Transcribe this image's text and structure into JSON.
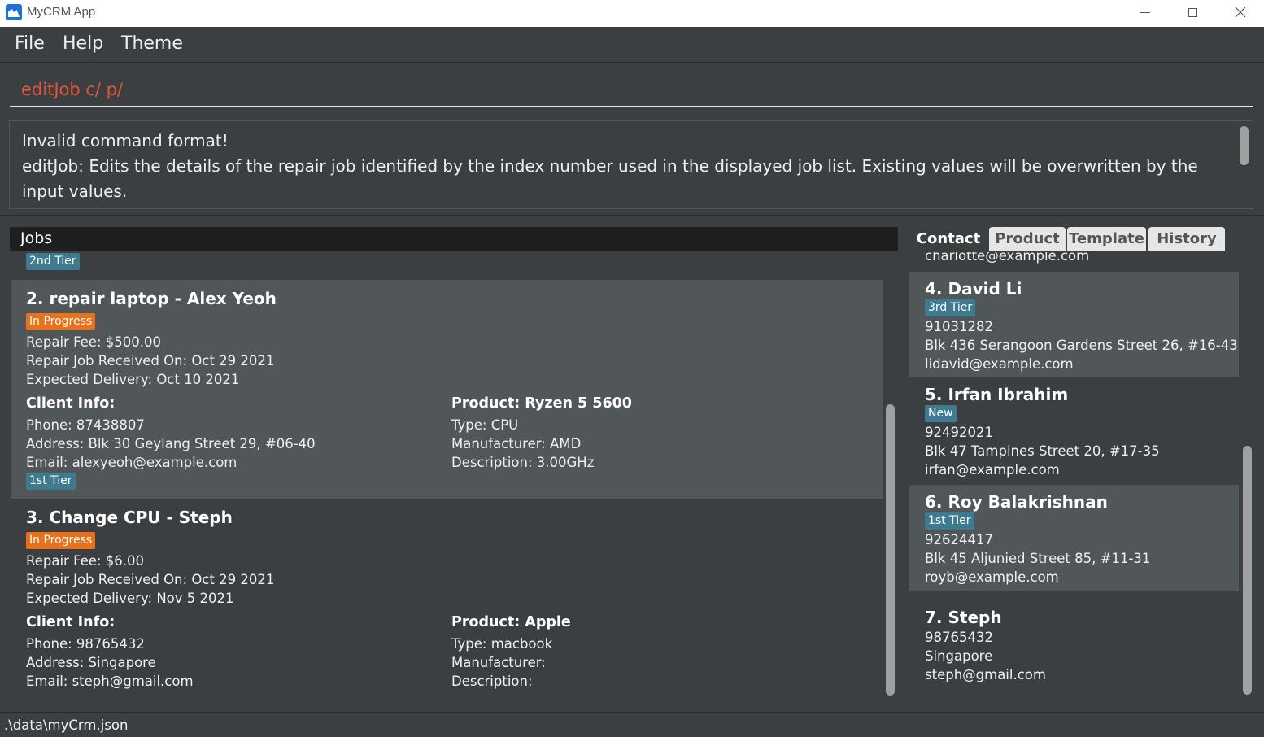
{
  "window": {
    "title": "MyCRM App"
  },
  "menu": {
    "file": "File",
    "help": "Help",
    "theme": "Theme"
  },
  "command": {
    "value": "editJob c/ p/"
  },
  "result": {
    "line1": "Invalid command format!",
    "line2": "editJob: Edits the details of the repair job identified by the index number used in the displayed job list. Existing values will be overwritten by the input values."
  },
  "jobs": {
    "header": "Jobs",
    "partial_tag": "2nd Tier",
    "items": [
      {
        "title": "2. repair laptop - Alex Yeoh",
        "status": "In Progress",
        "fee": "Repair Fee: $500.00",
        "received": "Repair Job Received On: Oct 29 2021",
        "delivery": "Expected Delivery: Oct 10 2021",
        "client_heading": "Client Info:",
        "phone": "Phone: 87438807",
        "address": "Address: Blk 30 Geylang Street 29, #06-40",
        "email": "Email: alexyeoh@example.com",
        "tier": "1st Tier",
        "product_heading": "Product: Ryzen 5 5600",
        "type": "Type: CPU",
        "manufacturer": "Manufacturer: AMD",
        "description": "Description: 3.00GHz"
      },
      {
        "title": "3. Change CPU - Steph",
        "status": "In Progress",
        "fee": "Repair Fee: $6.00",
        "received": "Repair Job Received On: Oct 29 2021",
        "delivery": "Expected Delivery: Nov 5 2021",
        "client_heading": "Client Info:",
        "phone": "Phone: 98765432",
        "address": "Address: Singapore",
        "email": "Email: steph@gmail.com",
        "product_heading": "Product: Apple",
        "type": "Type: macbook",
        "manufacturer": "Manufacturer:",
        "description": "Description:"
      }
    ]
  },
  "tabs": {
    "contact": "Contact",
    "product": "Product",
    "template": "Template",
    "history": "History"
  },
  "contacts": {
    "partial_email": "charlotte@example.com",
    "items": [
      {
        "name": "4.  David Li",
        "tag": "3rd Tier",
        "phone": "91031282",
        "address": "Blk 436 Serangoon Gardens Street 26, #16-43",
        "email": "lidavid@example.com"
      },
      {
        "name": "5.  Irfan Ibrahim",
        "tag": "New",
        "phone": "92492021",
        "address": "Blk 47 Tampines Street 20, #17-35",
        "email": "irfan@example.com"
      },
      {
        "name": "6.  Roy Balakrishnan",
        "tag": "1st Tier",
        "phone": "92624417",
        "address": "Blk 45 Aljunied Street 85, #11-31",
        "email": "royb@example.com"
      },
      {
        "name": "7.  Steph",
        "phone": "98765432",
        "address": "Singapore",
        "email": "steph@gmail.com"
      }
    ]
  },
  "status": {
    "path": ".\\data\\myCrm.json"
  },
  "colors": {
    "accent_command": "#e0553a",
    "status_tag": "#e8711c",
    "tier_tag": "#3e7b91",
    "card_alt": "#515658",
    "background": "#3c3f41"
  }
}
